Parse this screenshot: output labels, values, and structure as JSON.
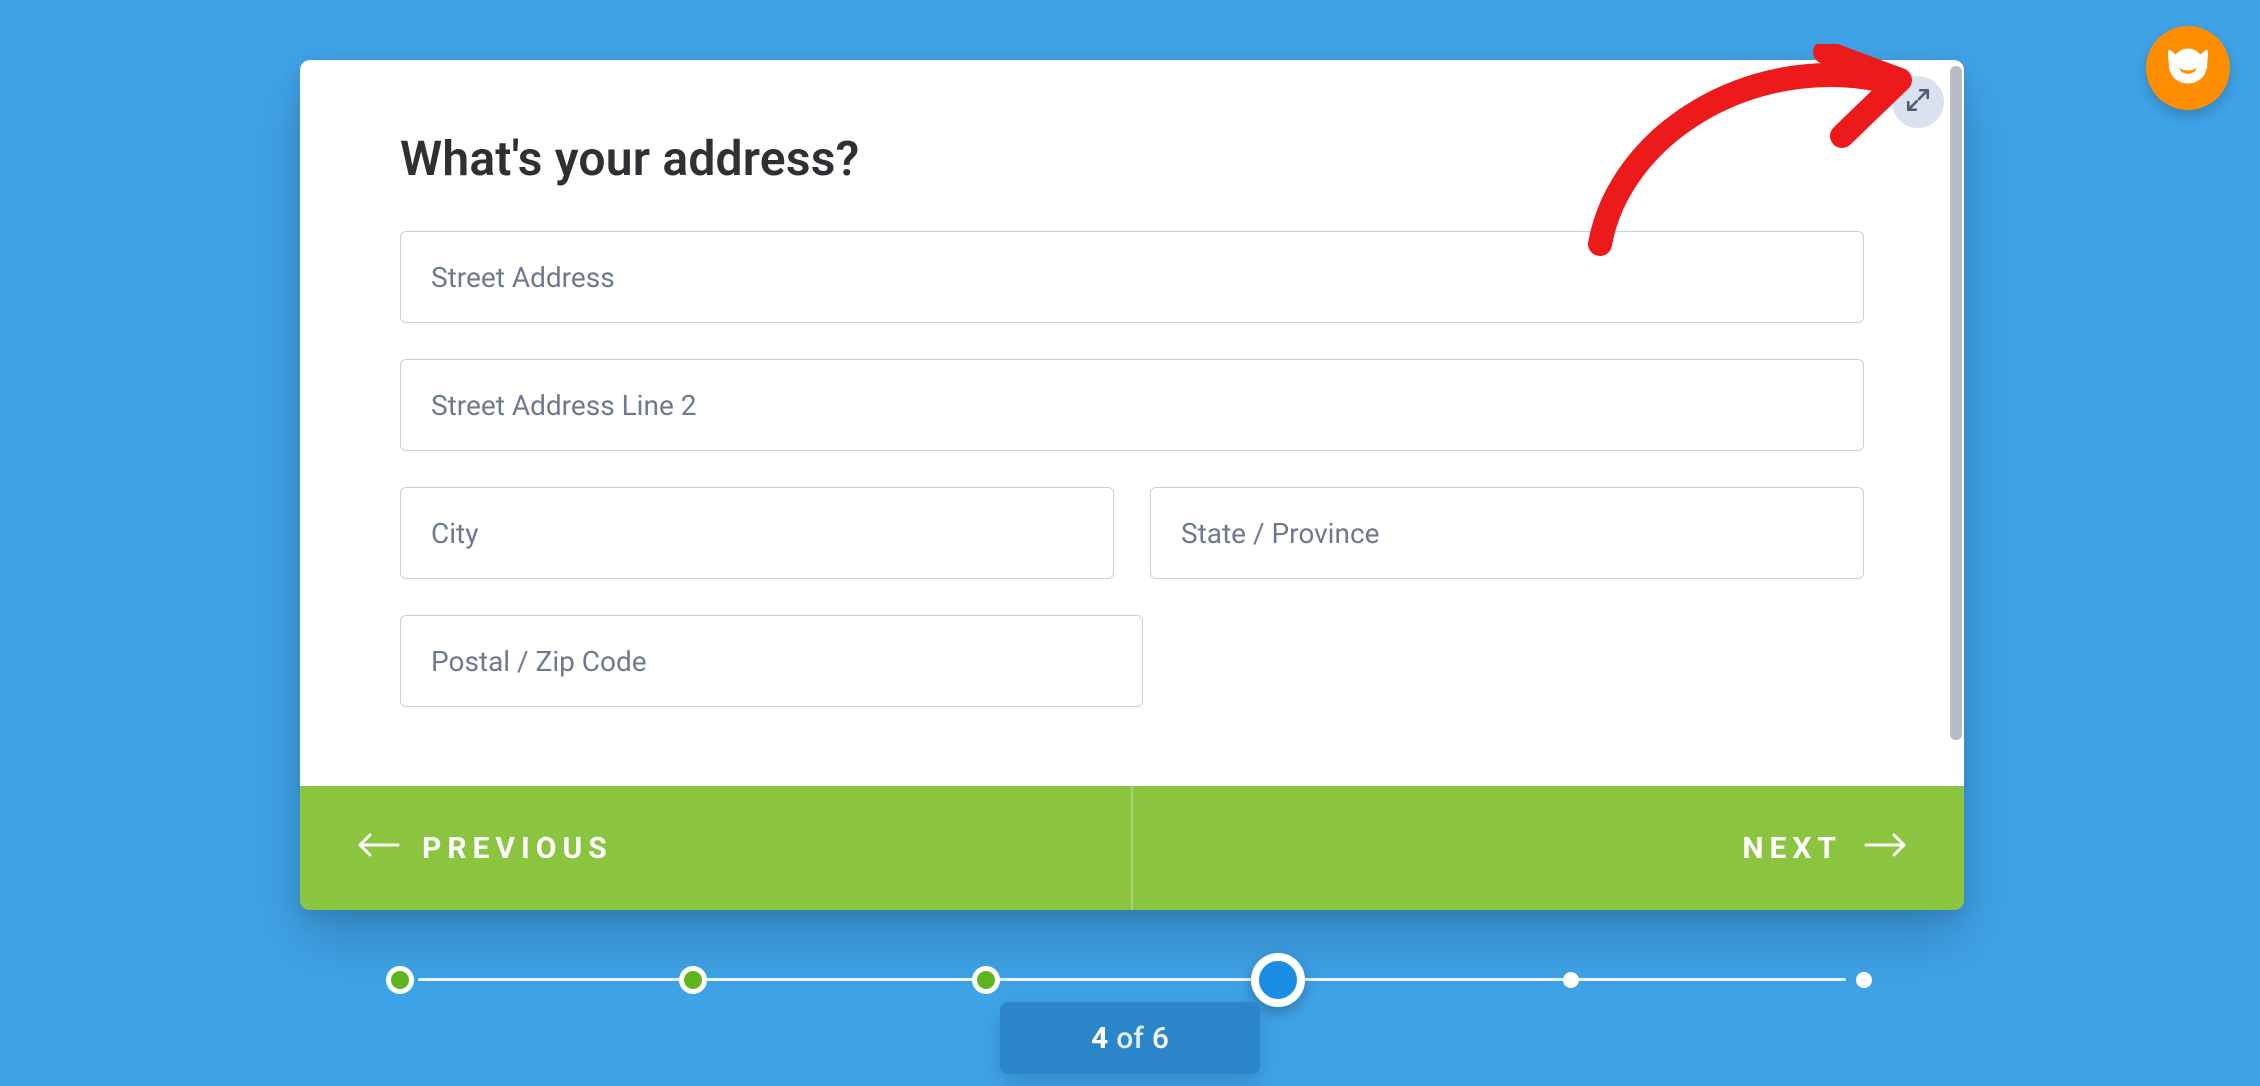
{
  "colors": {
    "background": "#3fa3e8",
    "accent_green": "#8bc53f",
    "progress_done": "#5fb51c",
    "progress_current": "#1b8de4",
    "brand_orange": "#ff8d00",
    "annotation_red": "#ec1a1a"
  },
  "header": {
    "title": "What's your address?"
  },
  "fields": {
    "street": {
      "placeholder": "Street Address",
      "value": ""
    },
    "street2": {
      "placeholder": "Street Address Line 2",
      "value": ""
    },
    "city": {
      "placeholder": "City",
      "value": ""
    },
    "state": {
      "placeholder": "State / Province",
      "value": ""
    },
    "postal": {
      "placeholder": "Postal / Zip Code",
      "value": ""
    }
  },
  "nav": {
    "prev_label": "PREVIOUS",
    "next_label": "NEXT"
  },
  "icons": {
    "expand": "expand-icon",
    "arrow_left": "arrow-left-icon",
    "arrow_right": "arrow-right-icon",
    "brand": "cat-icon"
  },
  "progress": {
    "current": "4",
    "of_label": "of",
    "total": "6",
    "steps": [
      {
        "state": "done"
      },
      {
        "state": "done"
      },
      {
        "state": "done"
      },
      {
        "state": "current"
      },
      {
        "state": "empty"
      },
      {
        "state": "empty"
      }
    ]
  }
}
